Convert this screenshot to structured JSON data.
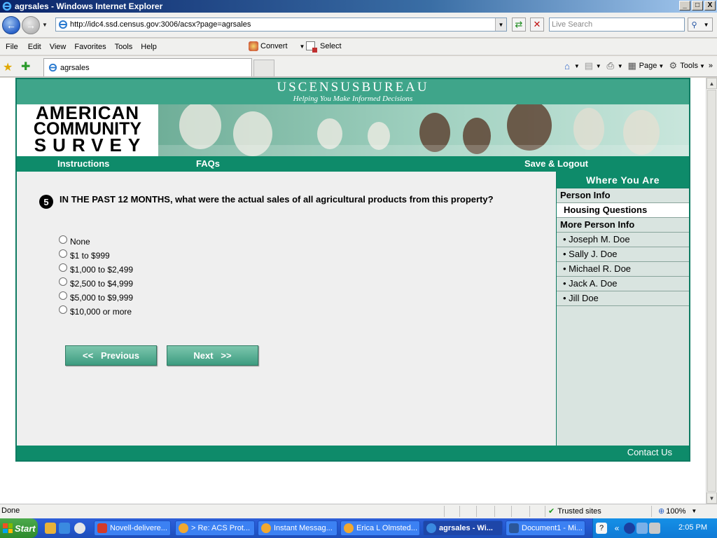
{
  "window": {
    "title": "agrsales - Windows Internet Explorer",
    "controls": {
      "minimize": "_",
      "maximize": "□",
      "close": "X"
    }
  },
  "addressbar": {
    "url": "http://idc4.ssd.census.gov:3006/acsx?page=agrsales",
    "search_placeholder": "Live Search"
  },
  "menubar": {
    "items": [
      "File",
      "Edit",
      "View",
      "Favorites",
      "Tools",
      "Help"
    ],
    "convert_label": "Convert",
    "select_label": "Select"
  },
  "tabs": {
    "active_label": "agrsales"
  },
  "commandbar": {
    "page_label": "Page",
    "tools_label": "Tools"
  },
  "page": {
    "census_title": "USCENSUSBUREAU",
    "census_tagline": "Helping You Make Informed Decisions",
    "logo": {
      "line1": "AMERICAN",
      "line2": "COMMUNITY",
      "line3": "SURVEY"
    },
    "nav": {
      "instructions": "Instructions",
      "faqs": "FAQs",
      "save_logout": "Save & Logout"
    },
    "question": {
      "number": "5",
      "text": "IN THE PAST 12 MONTHS, what were the actual sales of all agricultural products from this property?",
      "options": [
        "None",
        "$1 to $999",
        "$1,000 to $2,499",
        "$2,500 to $4,999",
        "$5,000 to $9,999",
        "$10,000 or more"
      ]
    },
    "buttons": {
      "previous": "<<   Previous",
      "next": "Next   >>"
    },
    "sidebar": {
      "heading": "Where You Are",
      "person_info": "Person Info",
      "housing": "Housing Questions",
      "more_person": "More Person Info",
      "people": [
        "• Joseph M. Doe",
        "• Sally J. Doe",
        "• Michael R. Doe",
        "• Jack A. Doe",
        "• Jill Doe"
      ]
    },
    "footer": {
      "contact": "Contact Us"
    }
  },
  "statusbar": {
    "status": "Done",
    "zone": "Trusted sites",
    "zoom": "100%"
  },
  "taskbar": {
    "start": "Start",
    "tasks": [
      "Novell-delivere...",
      "> Re: ACS Prot...",
      "Instant Messag...",
      "Erica L Olmsted...",
      "agrsales - Wi...",
      "Document1 - Mi..."
    ],
    "clock": "2:05 PM"
  },
  "colors": {
    "census_green": "#0e8b6a",
    "census_light": "#3fa58a",
    "sidebar_bg": "#d9e4e0"
  }
}
